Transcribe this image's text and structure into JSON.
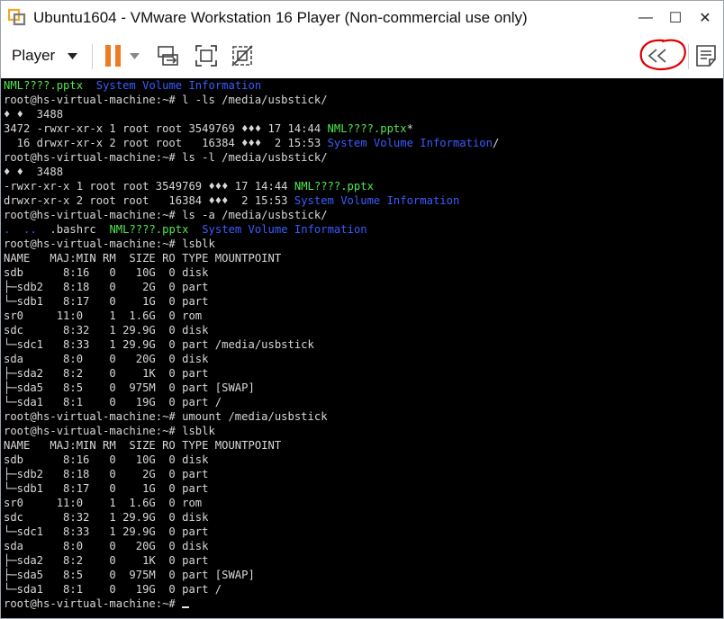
{
  "window": {
    "title": "Ubuntu1604 - VMware Workstation 16 Player (Non-commercial use only)",
    "minimize": "—",
    "maximize": "☐",
    "close": "✕"
  },
  "toolbar": {
    "player_label": "Player",
    "icons": [
      "pause-icon",
      "send-ctrl-alt-del-icon",
      "fit-window-icon",
      "unity-icon",
      "collapse-panel-icon",
      "notes-icon"
    ],
    "annotation_color": "#e00000"
  },
  "terminal": {
    "colors": {
      "text": "#d8d8d8",
      "green": "#4fe84f",
      "blue": "#3b5cff",
      "background": "#000000"
    },
    "lines": [
      [
        {
          "t": "NML????.pptx",
          "c": "green"
        },
        {
          "t": "  "
        },
        {
          "t": "System Volume Information",
          "c": "blue"
        }
      ],
      [
        {
          "t": "root@hs-virtual-machine:~# l -ls /media/usbstick/"
        }
      ],
      [
        {
          "t": "♦ ♦  3488"
        }
      ],
      [
        {
          "t": "3472 -rwxr-xr-x 1 root root 3549769 ♦♦♦ 17 14:44 "
        },
        {
          "t": "NML????.pptx",
          "c": "green"
        },
        {
          "t": "*"
        }
      ],
      [
        {
          "t": "  16 drwxr-xr-x 2 root root   16384 ♦♦♦  2 15:53 "
        },
        {
          "t": "System Volume Information",
          "c": "blue"
        },
        {
          "t": "/"
        }
      ],
      [
        {
          "t": "root@hs-virtual-machine:~# ls -l /media/usbstick/"
        }
      ],
      [
        {
          "t": "♦ ♦  3488"
        }
      ],
      [
        {
          "t": "-rwxr-xr-x 1 root root 3549769 ♦♦♦ 17 14:44 "
        },
        {
          "t": "NML????.pptx",
          "c": "green"
        }
      ],
      [
        {
          "t": "drwxr-xr-x 2 root root   16384 ♦♦♦  2 15:53 "
        },
        {
          "t": "System Volume Information",
          "c": "blue"
        }
      ],
      [
        {
          "t": "root@hs-virtual-machine:~# ls -a /media/usbstick/"
        }
      ],
      [
        {
          "t": ".",
          "c": "blue"
        },
        {
          "t": "  "
        },
        {
          "t": "..",
          "c": "blue"
        },
        {
          "t": "  .bashrc  "
        },
        {
          "t": "NML????.pptx",
          "c": "green"
        },
        {
          "t": "  "
        },
        {
          "t": "System Volume Information",
          "c": "blue"
        }
      ],
      [
        {
          "t": "root@hs-virtual-machine:~# lsblk"
        }
      ],
      [
        {
          "t": "NAME   MAJ:MIN RM  SIZE RO TYPE MOUNTPOINT"
        }
      ],
      [
        {
          "t": "sdb      8:16   0   10G  0 disk"
        }
      ],
      [
        {
          "t": "├─sdb2   8:18   0    2G  0 part"
        }
      ],
      [
        {
          "t": "└─sdb1   8:17   0    1G  0 part"
        }
      ],
      [
        {
          "t": "sr0     11:0    1  1.6G  0 rom"
        }
      ],
      [
        {
          "t": "sdc      8:32   1 29.9G  0 disk"
        }
      ],
      [
        {
          "t": "└─sdc1   8:33   1 29.9G  0 part /media/usbstick"
        }
      ],
      [
        {
          "t": "sda      8:0    0   20G  0 disk"
        }
      ],
      [
        {
          "t": "├─sda2   8:2    0    1K  0 part"
        }
      ],
      [
        {
          "t": "├─sda5   8:5    0  975M  0 part [SWAP]"
        }
      ],
      [
        {
          "t": "└─sda1   8:1    0   19G  0 part /"
        }
      ],
      [
        {
          "t": "root@hs-virtual-machine:~# umount /media/usbstick"
        }
      ],
      [
        {
          "t": "root@hs-virtual-machine:~# lsblk"
        }
      ],
      [
        {
          "t": "NAME   MAJ:MIN RM  SIZE RO TYPE MOUNTPOINT"
        }
      ],
      [
        {
          "t": "sdb      8:16   0   10G  0 disk"
        }
      ],
      [
        {
          "t": "├─sdb2   8:18   0    2G  0 part"
        }
      ],
      [
        {
          "t": "└─sdb1   8:17   0    1G  0 part"
        }
      ],
      [
        {
          "t": "sr0     11:0    1  1.6G  0 rom"
        }
      ],
      [
        {
          "t": "sdc      8:32   1 29.9G  0 disk"
        }
      ],
      [
        {
          "t": "└─sdc1   8:33   1 29.9G  0 part"
        }
      ],
      [
        {
          "t": "sda      8:0    0   20G  0 disk"
        }
      ],
      [
        {
          "t": "├─sda2   8:2    0    1K  0 part"
        }
      ],
      [
        {
          "t": "├─sda5   8:5    0  975M  0 part [SWAP]"
        }
      ],
      [
        {
          "t": "└─sda1   8:1    0   19G  0 part /"
        }
      ],
      [
        {
          "t": "root@hs-virtual-machine:~# "
        }
      ]
    ]
  }
}
